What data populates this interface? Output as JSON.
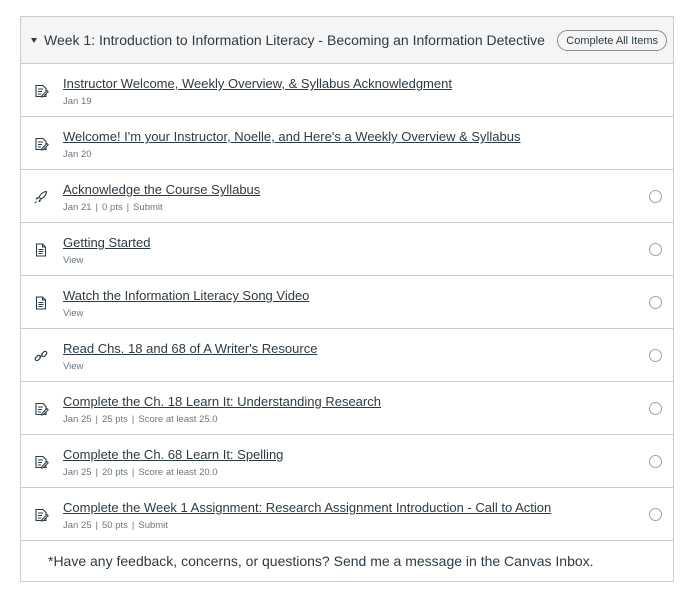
{
  "module": {
    "title": "Week 1: Introduction to Information Literacy - Becoming an Information Detective",
    "complete_all_label": "Complete All Items"
  },
  "items": [
    {
      "icon": "assignment-icon",
      "title": "Instructor Welcome, Weekly Overview, & Syllabus Acknowledgment",
      "date": "Jan 19",
      "points": "",
      "req": "",
      "has_radio": false
    },
    {
      "icon": "assignment-icon",
      "title": "Welcome! I'm your Instructor, Noelle, and Here's a Weekly Overview & Syllabus",
      "date": "Jan 20",
      "points": "",
      "req": "",
      "has_radio": false
    },
    {
      "icon": "quiz-icon",
      "title": "Acknowledge the Course Syllabus",
      "date": "Jan 21",
      "points": "0 pts",
      "req": "Submit",
      "has_radio": true
    },
    {
      "icon": "page-icon",
      "title": "Getting Started",
      "date": "",
      "points": "",
      "req": "View",
      "has_radio": true
    },
    {
      "icon": "page-icon",
      "title": "Watch the Information Literacy Song Video",
      "date": "",
      "points": "",
      "req": "View",
      "has_radio": true
    },
    {
      "icon": "link-icon",
      "title": "Read Chs. 18 and 68 of A Writer's Resource",
      "date": "",
      "points": "",
      "req": "View",
      "has_radio": true
    },
    {
      "icon": "assignment-icon",
      "title": "Complete the Ch. 18 Learn It: Understanding Research",
      "date": "Jan 25",
      "points": "25 pts",
      "req": "Score at least 25.0",
      "has_radio": true
    },
    {
      "icon": "assignment-icon",
      "title": "Complete the Ch. 68 Learn It: Spelling",
      "date": "Jan 25",
      "points": "20 pts",
      "req": "Score at least 20.0",
      "has_radio": true
    },
    {
      "icon": "assignment-icon",
      "title": "Complete the Week 1 Assignment: Research Assignment Introduction - Call to Action",
      "date": "Jan 25",
      "points": "50 pts",
      "req": "Submit",
      "has_radio": true
    }
  ],
  "footer": {
    "text": "*Have any feedback, concerns, or questions? Send me a message in the Canvas Inbox."
  }
}
